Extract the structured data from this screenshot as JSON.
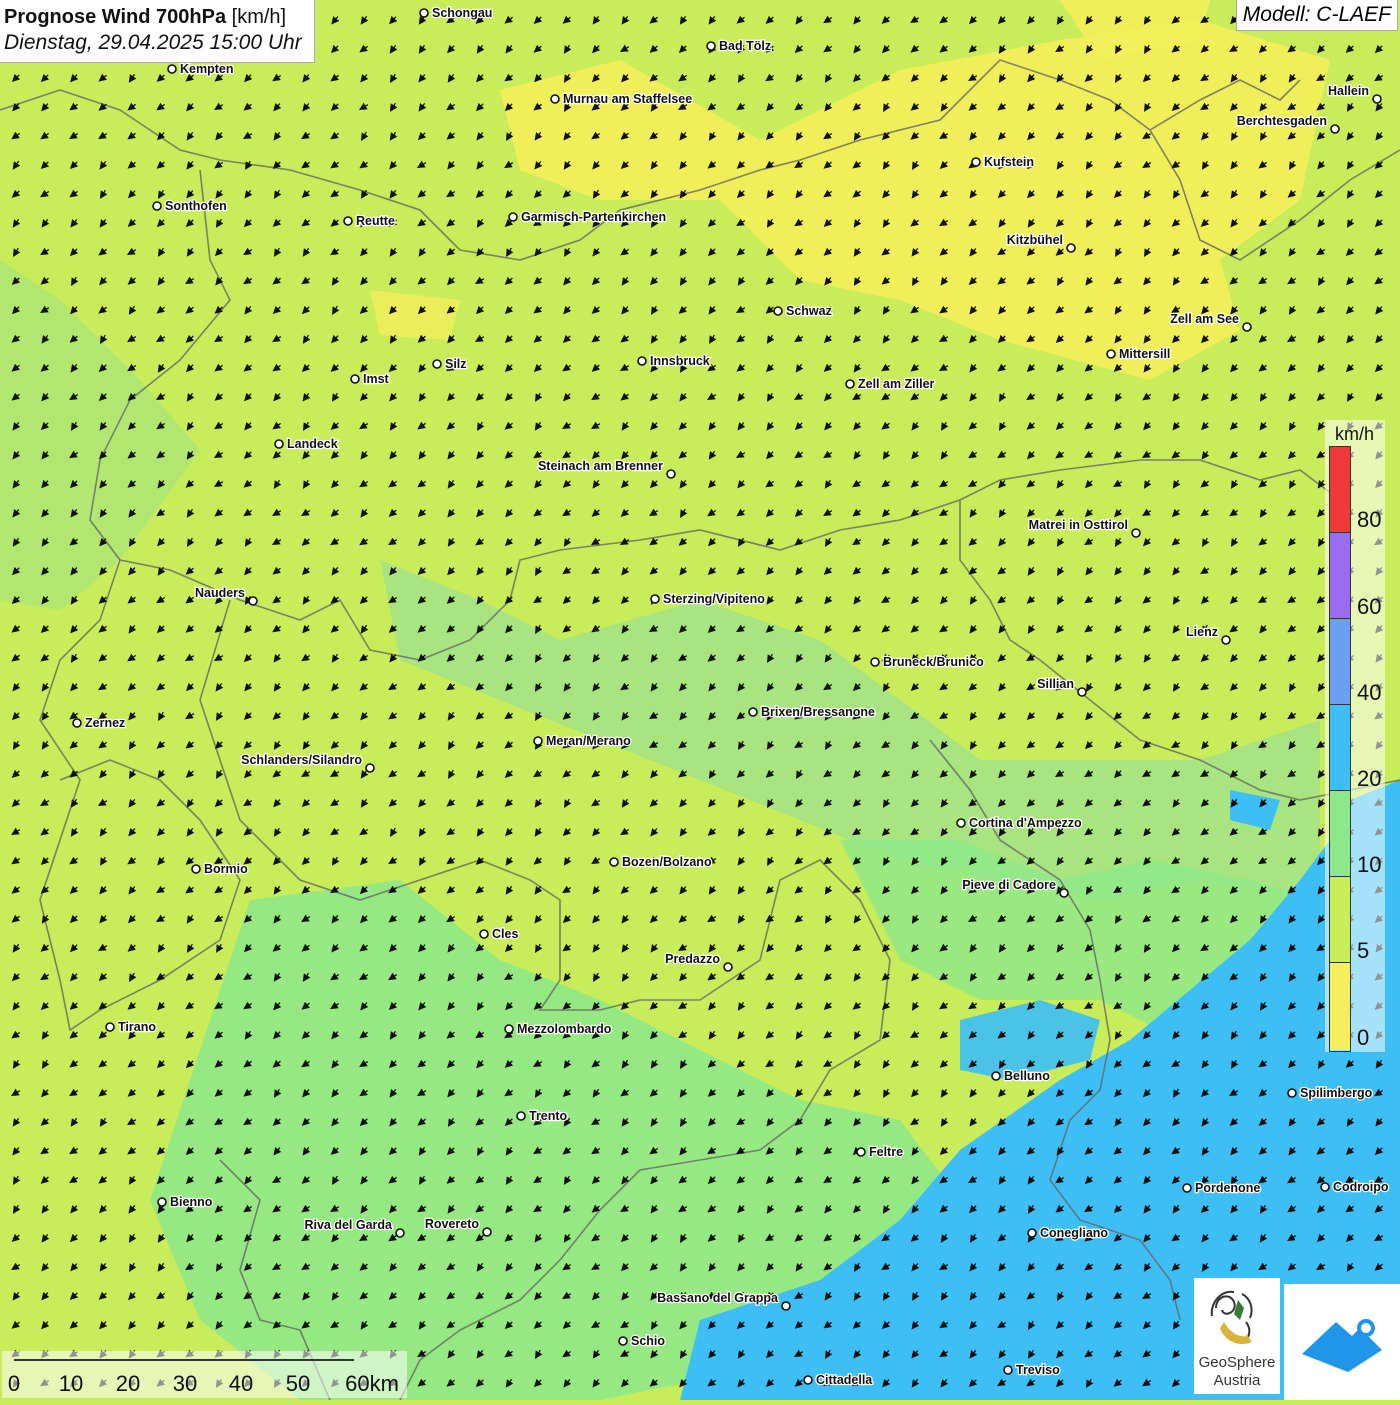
{
  "title": {
    "main": "Prognose Wind 700hPa",
    "unit": "[km/h]",
    "datetime": "Dienstag, 29.04.2025 15:00 Uhr"
  },
  "model": "Modell: C-LAEF",
  "legend": {
    "unit": "km/h",
    "labels": [
      "80",
      "60",
      "40",
      "20",
      "10",
      "5",
      "0"
    ],
    "colors": [
      "#f03a3a",
      "#9b6cf0",
      "#6a9ff2",
      "#3dbff5",
      "#8de88a",
      "#c9ec5a",
      "#f4ef5a"
    ]
  },
  "wind_field": {
    "direction": "southwest",
    "colors": {
      "calm": "#f4ef5a",
      "light": "#c9ec5a",
      "moderate": "#8de88a",
      "strong": "#3dbff5"
    }
  },
  "cities": [
    "Schongau",
    "Bad Tölz",
    "Kempten",
    "Murnau am Staffelsee",
    "Hallein",
    "Berchtesgaden",
    "Kufstein",
    "Sonthofen",
    "Reutte",
    "Garmisch-Partenkirchen",
    "Kitzbühel",
    "Schwaz",
    "Zell am See",
    "Mittersill",
    "Silz",
    "Innsbruck",
    "Imst",
    "Zell am Ziller",
    "Landeck",
    "Steinach am Brenner",
    "Matrei in Osttirol",
    "Nauders",
    "Sterzing/Vipiteno",
    "Lienz",
    "Bruneck/Brunico",
    "Sillian",
    "Zernez",
    "Brixen/Bressanone",
    "Meran/Merano",
    "Schlanders/Silandro",
    "Cortina d'Ampezzo",
    "Bozen/Bolzano",
    "Bormio",
    "Pieve di Cadore",
    "Cles",
    "Predazzo",
    "Tirano",
    "Mezzolombardo",
    "Belluno",
    "Spilimbergo",
    "Trento",
    "Feltre",
    "Bienno",
    "Pordenone",
    "Codroipo",
    "Riva del Garda",
    "Rovereto",
    "Conegliano",
    "Bassano del Grappa",
    "Schio",
    "Treviso",
    "Cittadella"
  ],
  "scale_bar": {
    "labels": [
      "0",
      "10",
      "20",
      "30",
      "40",
      "50",
      "60km"
    ]
  },
  "logos": {
    "geosphere": "GeoSphere\nAustria",
    "geosphere_icon": "geosphere-logo",
    "second_icon": "mountain-logo"
  }
}
